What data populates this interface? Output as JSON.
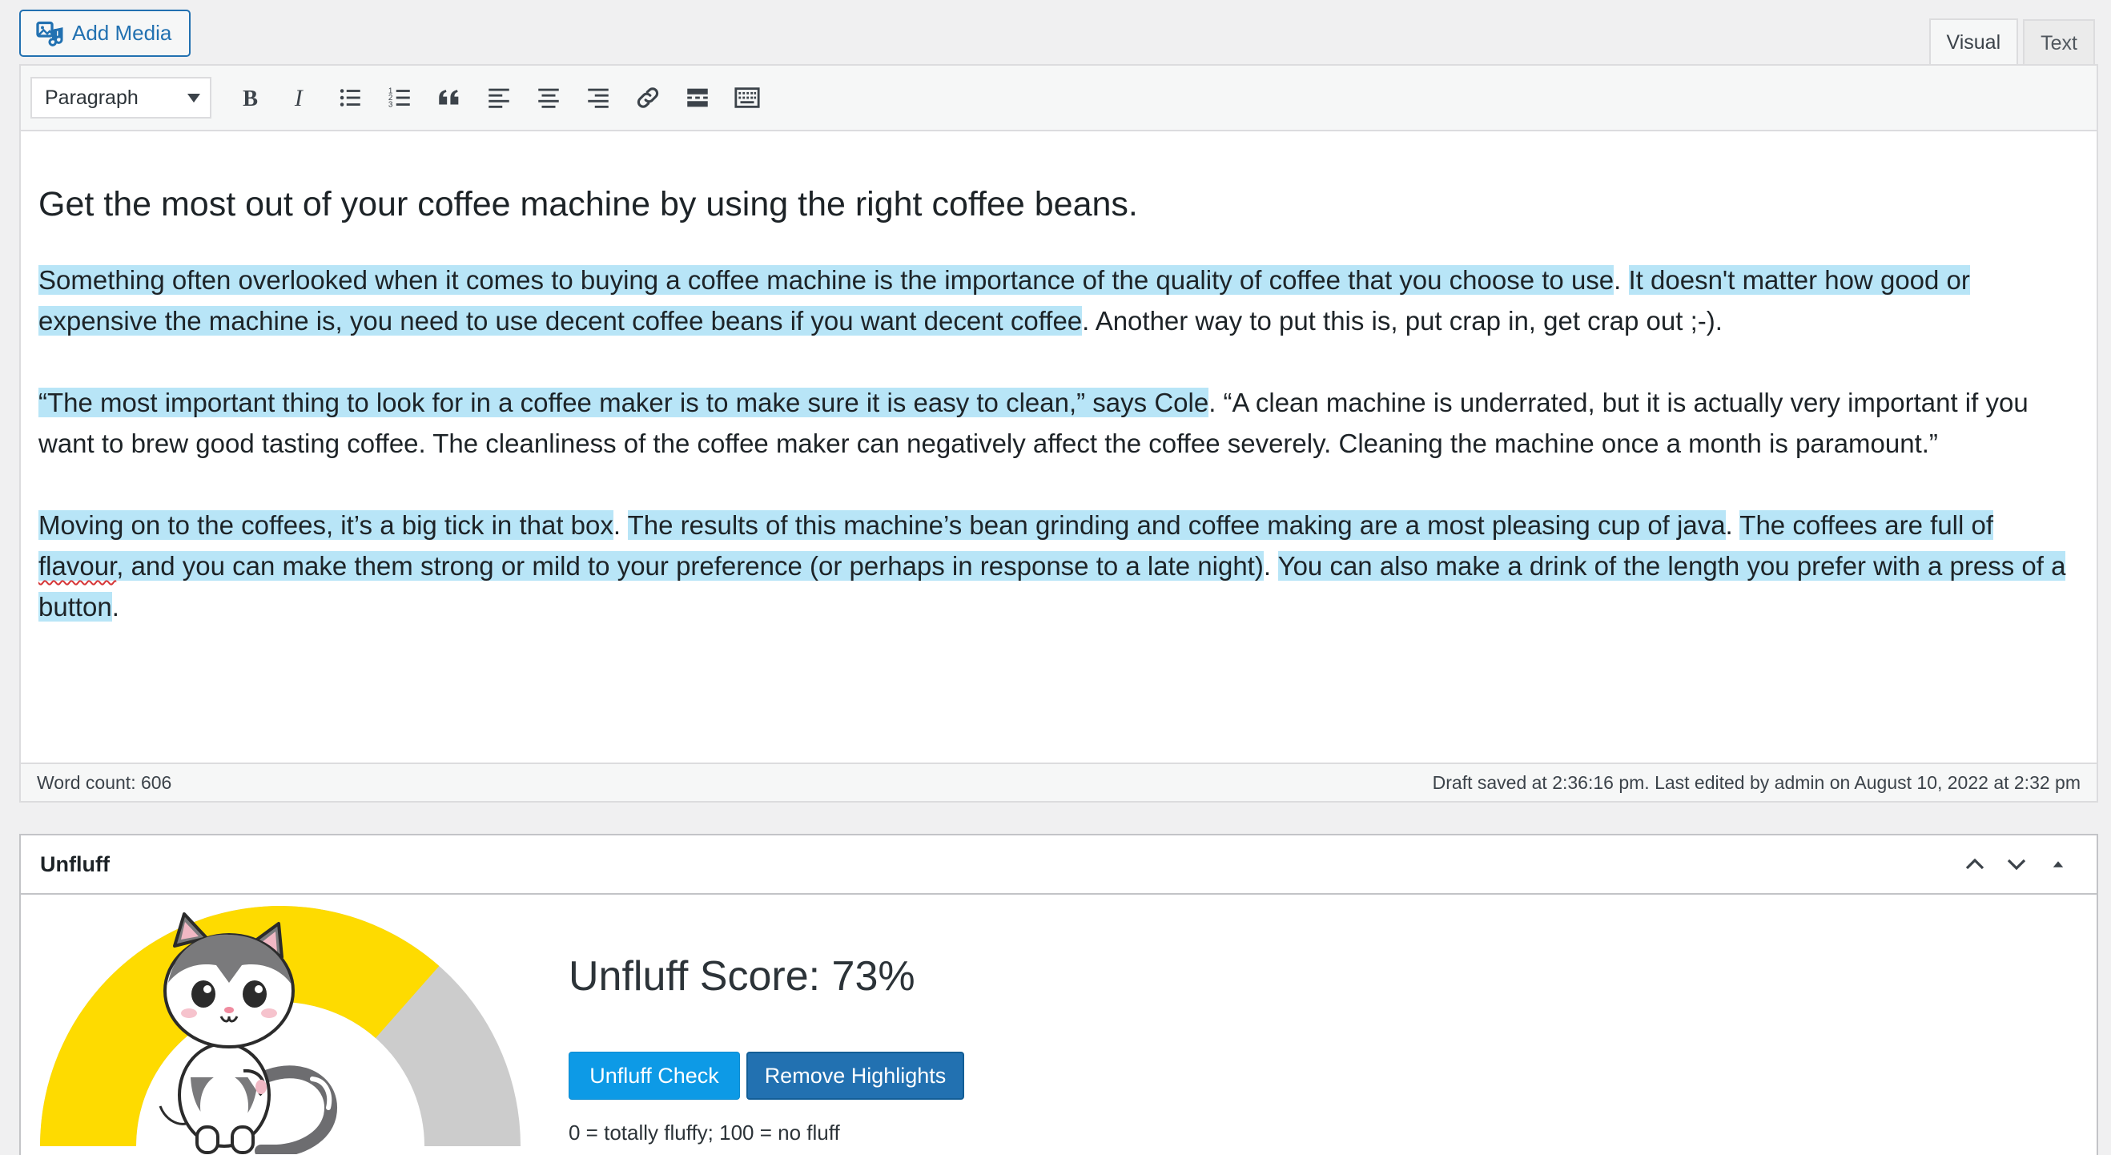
{
  "top": {
    "add_media_label": "Add Media",
    "tabs": [
      {
        "label": "Visual",
        "active": true
      },
      {
        "label": "Text",
        "active": false
      }
    ]
  },
  "toolbar": {
    "format_value": "Paragraph",
    "buttons": [
      {
        "name": "bold-icon"
      },
      {
        "name": "italic-icon"
      },
      {
        "name": "bulleted-list-icon"
      },
      {
        "name": "numbered-list-icon"
      },
      {
        "name": "blockquote-icon"
      },
      {
        "name": "align-left-icon"
      },
      {
        "name": "align-center-icon"
      },
      {
        "name": "align-right-icon"
      },
      {
        "name": "link-icon"
      },
      {
        "name": "read-more-icon"
      },
      {
        "name": "toolbar-toggle-icon"
      }
    ]
  },
  "content": {
    "heading": "Get the most out of your coffee machine by using the right coffee beans.",
    "p1": {
      "s1": "Something often overlooked when it comes to buying a coffee machine is the importance of the quality of coffee that you choose to use",
      "s1_end": ".",
      "s2": "It doesn't matter how good or expensive the machine is, you need to use decent coffee beans if you want decent coffee",
      "s2_end": ". Another way to put this is, put crap in, get crap out ;-)."
    },
    "p2": {
      "s1": "“The most important thing to look for in a coffee maker is to make sure it is easy to clean,” says Cole",
      "rest": ". “A clean machine is underrated, but it is actually very important if you want to brew good tasting coffee. The cleanliness of the coffee maker can negatively affect the coffee severely. Cleaning the machine once a month is paramount.”"
    },
    "p3": {
      "s1": "Moving on to the coffees, it’s a big tick in that box",
      "s1_end": ".",
      "s2": "The results of this machine’s bean grinding and coffee making are a most pleasing cup of java",
      "s2_end": ".",
      "s3a": "The coffees are full of ",
      "s3_spell": "flavour",
      "s3b": ", and you can make them strong or mild to your preference (or perhaps in response to a late night)",
      "s3_end": ".",
      "s4": "You can also make a drink of the length you prefer with a press of a button",
      "s4_end": "."
    }
  },
  "status": {
    "word_count": "Word count: 606",
    "draft_info": "Draft saved at 2:36:16 pm. Last edited by admin on August 10, 2022 at 2:32 pm"
  },
  "unfluff": {
    "title": "Unfluff",
    "score_text": "Unfluff Score: 73%",
    "score_value": 73,
    "check_button": "Unfluff Check",
    "remove_button": "Remove Highlights",
    "legend": "0 = totally fluffy; 100 = no fluff",
    "gauge_colors": {
      "filled": "#fedb00",
      "empty": "#cccccc"
    }
  },
  "colors": {
    "highlight": "#b8e5f7",
    "accent": "#2271b1",
    "check_button": "#0d9ae6"
  }
}
